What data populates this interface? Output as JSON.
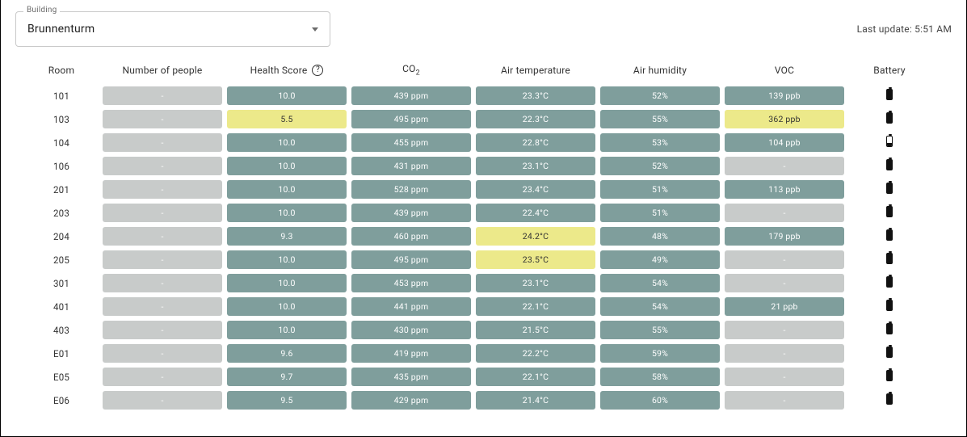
{
  "selector": {
    "label": "Building",
    "value": "Brunnenturm"
  },
  "last_update": {
    "prefix": "Last update:",
    "time": "5:51 AM"
  },
  "headers": {
    "room": "Room",
    "people": "Number of people",
    "health": "Health Score",
    "co2_pre": "CO",
    "co2_sub": "2",
    "temp": "Air temperature",
    "humidity": "Air humidity",
    "voc": "VOC",
    "battery": "Battery"
  },
  "rows": [
    {
      "room": "101",
      "people": {
        "v": "-",
        "c": "grey"
      },
      "health": {
        "v": "10.0",
        "c": "green"
      },
      "co2": {
        "v": "439 ppm",
        "c": "green"
      },
      "temp": {
        "v": "23.3°C",
        "c": "green"
      },
      "hum": {
        "v": "52%",
        "c": "green"
      },
      "voc": {
        "v": "139 ppb",
        "c": "green"
      },
      "battery": "full"
    },
    {
      "room": "103",
      "people": {
        "v": "-",
        "c": "grey"
      },
      "health": {
        "v": "5.5",
        "c": "yellow"
      },
      "co2": {
        "v": "495 ppm",
        "c": "green"
      },
      "temp": {
        "v": "22.3°C",
        "c": "green"
      },
      "hum": {
        "v": "55%",
        "c": "green"
      },
      "voc": {
        "v": "362 ppb",
        "c": "yellow"
      },
      "battery": "full"
    },
    {
      "room": "104",
      "people": {
        "v": "-",
        "c": "grey"
      },
      "health": {
        "v": "10.0",
        "c": "green"
      },
      "co2": {
        "v": "455 ppm",
        "c": "green"
      },
      "temp": {
        "v": "22.8°C",
        "c": "green"
      },
      "hum": {
        "v": "53%",
        "c": "green"
      },
      "voc": {
        "v": "104 ppb",
        "c": "green"
      },
      "battery": "low"
    },
    {
      "room": "106",
      "people": {
        "v": "-",
        "c": "grey"
      },
      "health": {
        "v": "10.0",
        "c": "green"
      },
      "co2": {
        "v": "431 ppm",
        "c": "green"
      },
      "temp": {
        "v": "23.1°C",
        "c": "green"
      },
      "hum": {
        "v": "52%",
        "c": "green"
      },
      "voc": {
        "v": "-",
        "c": "grey"
      },
      "battery": "full"
    },
    {
      "room": "201",
      "people": {
        "v": "-",
        "c": "grey"
      },
      "health": {
        "v": "10.0",
        "c": "green"
      },
      "co2": {
        "v": "528 ppm",
        "c": "green"
      },
      "temp": {
        "v": "23.4°C",
        "c": "green"
      },
      "hum": {
        "v": "51%",
        "c": "green"
      },
      "voc": {
        "v": "113 ppb",
        "c": "green"
      },
      "battery": "full"
    },
    {
      "room": "203",
      "people": {
        "v": "-",
        "c": "grey"
      },
      "health": {
        "v": "10.0",
        "c": "green"
      },
      "co2": {
        "v": "439 ppm",
        "c": "green"
      },
      "temp": {
        "v": "22.4°C",
        "c": "green"
      },
      "hum": {
        "v": "51%",
        "c": "green"
      },
      "voc": {
        "v": "-",
        "c": "grey"
      },
      "battery": "full"
    },
    {
      "room": "204",
      "people": {
        "v": "-",
        "c": "grey"
      },
      "health": {
        "v": "9.3",
        "c": "green"
      },
      "co2": {
        "v": "460 ppm",
        "c": "green"
      },
      "temp": {
        "v": "24.2°C",
        "c": "yellow"
      },
      "hum": {
        "v": "48%",
        "c": "green"
      },
      "voc": {
        "v": "179 ppb",
        "c": "green"
      },
      "battery": "full"
    },
    {
      "room": "205",
      "people": {
        "v": "-",
        "c": "grey"
      },
      "health": {
        "v": "10.0",
        "c": "green"
      },
      "co2": {
        "v": "495 ppm",
        "c": "green"
      },
      "temp": {
        "v": "23.5°C",
        "c": "yellow"
      },
      "hum": {
        "v": "49%",
        "c": "green"
      },
      "voc": {
        "v": "-",
        "c": "grey"
      },
      "battery": "full"
    },
    {
      "room": "301",
      "people": {
        "v": "-",
        "c": "grey"
      },
      "health": {
        "v": "10.0",
        "c": "green"
      },
      "co2": {
        "v": "453 ppm",
        "c": "green"
      },
      "temp": {
        "v": "23.1°C",
        "c": "green"
      },
      "hum": {
        "v": "54%",
        "c": "green"
      },
      "voc": {
        "v": "-",
        "c": "grey"
      },
      "battery": "full"
    },
    {
      "room": "401",
      "people": {
        "v": "-",
        "c": "grey"
      },
      "health": {
        "v": "10.0",
        "c": "green"
      },
      "co2": {
        "v": "441 ppm",
        "c": "green"
      },
      "temp": {
        "v": "22.1°C",
        "c": "green"
      },
      "hum": {
        "v": "54%",
        "c": "green"
      },
      "voc": {
        "v": "21 ppb",
        "c": "green"
      },
      "battery": "full"
    },
    {
      "room": "403",
      "people": {
        "v": "-",
        "c": "grey"
      },
      "health": {
        "v": "10.0",
        "c": "green"
      },
      "co2": {
        "v": "430 ppm",
        "c": "green"
      },
      "temp": {
        "v": "21.5°C",
        "c": "green"
      },
      "hum": {
        "v": "55%",
        "c": "green"
      },
      "voc": {
        "v": "-",
        "c": "grey"
      },
      "battery": "full"
    },
    {
      "room": "E01",
      "people": {
        "v": "-",
        "c": "grey"
      },
      "health": {
        "v": "9.6",
        "c": "green"
      },
      "co2": {
        "v": "419 ppm",
        "c": "green"
      },
      "temp": {
        "v": "22.2°C",
        "c": "green"
      },
      "hum": {
        "v": "59%",
        "c": "green"
      },
      "voc": {
        "v": "-",
        "c": "grey"
      },
      "battery": "full"
    },
    {
      "room": "E05",
      "people": {
        "v": "-",
        "c": "grey"
      },
      "health": {
        "v": "9.7",
        "c": "green"
      },
      "co2": {
        "v": "435 ppm",
        "c": "green"
      },
      "temp": {
        "v": "22.1°C",
        "c": "green"
      },
      "hum": {
        "v": "58%",
        "c": "green"
      },
      "voc": {
        "v": "-",
        "c": "grey"
      },
      "battery": "full"
    },
    {
      "room": "E06",
      "people": {
        "v": "-",
        "c": "grey"
      },
      "health": {
        "v": "9.5",
        "c": "green"
      },
      "co2": {
        "v": "429 ppm",
        "c": "green"
      },
      "temp": {
        "v": "21.4°C",
        "c": "green"
      },
      "hum": {
        "v": "60%",
        "c": "green"
      },
      "voc": {
        "v": "-",
        "c": "grey"
      },
      "battery": "full"
    }
  ]
}
